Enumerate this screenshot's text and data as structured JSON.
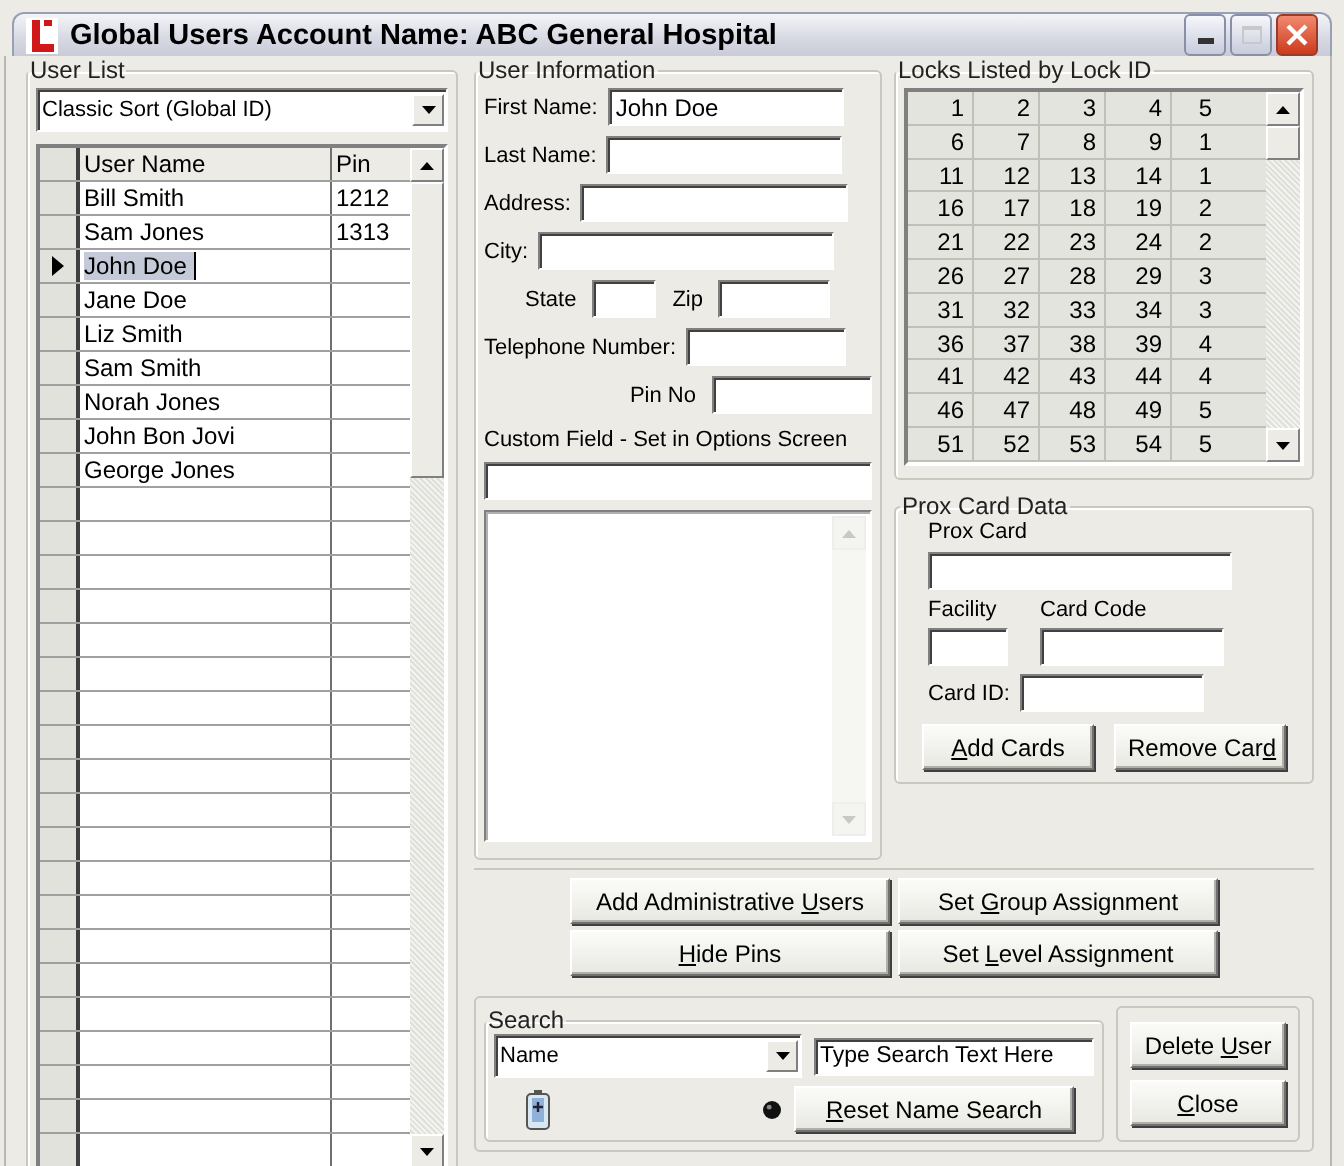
{
  "window": {
    "title": "Global Users Account Name: ABC General Hospital"
  },
  "user_list": {
    "title": "User List",
    "sort": "Classic Sort (Global ID)",
    "columns": [
      "User Name",
      "Pin"
    ],
    "rows": [
      {
        "name": "Bill Smith",
        "pin": "1212",
        "selected": false
      },
      {
        "name": "Sam Jones",
        "pin": "1313",
        "selected": false
      },
      {
        "name": "John Doe",
        "selected": true
      },
      {
        "name": "Jane Doe",
        "selected": false
      },
      {
        "name": "Liz Smith",
        "selected": false
      },
      {
        "name": "Sam Smith",
        "selected": false
      },
      {
        "name": "Norah Jones",
        "selected": false
      },
      {
        "name": "John Bon Jovi",
        "selected": false
      },
      {
        "name": "George Jones",
        "selected": false
      }
    ]
  },
  "user_information": {
    "title": "User Information",
    "first_name": {
      "label": "First Name:",
      "value": "John Doe"
    },
    "last_name": {
      "label": "Last Name:"
    },
    "address": {
      "label": "Address:"
    },
    "city": {
      "label": "City:"
    },
    "state": {
      "label": "State"
    },
    "zip": {
      "label": "Zip"
    },
    "telephone": {
      "label": "Telephone Number:"
    },
    "pin_no": {
      "label": "Pin No"
    },
    "custom_field": {
      "label": "Custom Field - Set in Options Screen"
    }
  },
  "locks": {
    "title": "Locks Listed by Lock ID",
    "rows": [
      [
        "1",
        "2",
        "3",
        "4",
        "5"
      ],
      [
        "6",
        "7",
        "8",
        "9",
        "1"
      ],
      [
        "11",
        "12",
        "13",
        "14",
        "1"
      ],
      [
        "16",
        "17",
        "18",
        "19",
        "2"
      ],
      [
        "21",
        "22",
        "23",
        "24",
        "2"
      ],
      [
        "26",
        "27",
        "28",
        "29",
        "3"
      ],
      [
        "31",
        "32",
        "33",
        "34",
        "3"
      ],
      [
        "36",
        "37",
        "38",
        "39",
        "4"
      ],
      [
        "41",
        "42",
        "43",
        "44",
        "4"
      ],
      [
        "46",
        "47",
        "48",
        "49",
        "5"
      ],
      [
        "51",
        "52",
        "53",
        "54",
        "5"
      ]
    ]
  },
  "prox_card": {
    "title": "Prox Card Data",
    "prox_card_label": "Prox Card",
    "facility_label": "Facility",
    "card_code_label": "Card Code",
    "card_id_label": "Card ID:",
    "buttons": [
      {
        "key": "A",
        "post": "dd Cards"
      },
      {
        "pre": "Remove Car",
        "key": "d"
      }
    ]
  },
  "admin_buttons": [
    {
      "pre": "Add Administrative ",
      "key": "U",
      "post": "sers"
    },
    {
      "pre": "Set ",
      "key": "G",
      "post": "roup Assignment"
    },
    {
      "key": "H",
      "post": "ide Pins"
    },
    {
      "pre": "Set ",
      "key": "L",
      "post": "evel Assignment"
    }
  ],
  "search": {
    "title": "Search",
    "field": "Name",
    "value": "Type Search Text Here",
    "reset_button": {
      "key": "R",
      "post": "eset Name Search"
    }
  },
  "actions": [
    {
      "pre": "Delete ",
      "key": "U",
      "post": "ser"
    },
    {
      "key": "C",
      "post": "lose"
    }
  ]
}
